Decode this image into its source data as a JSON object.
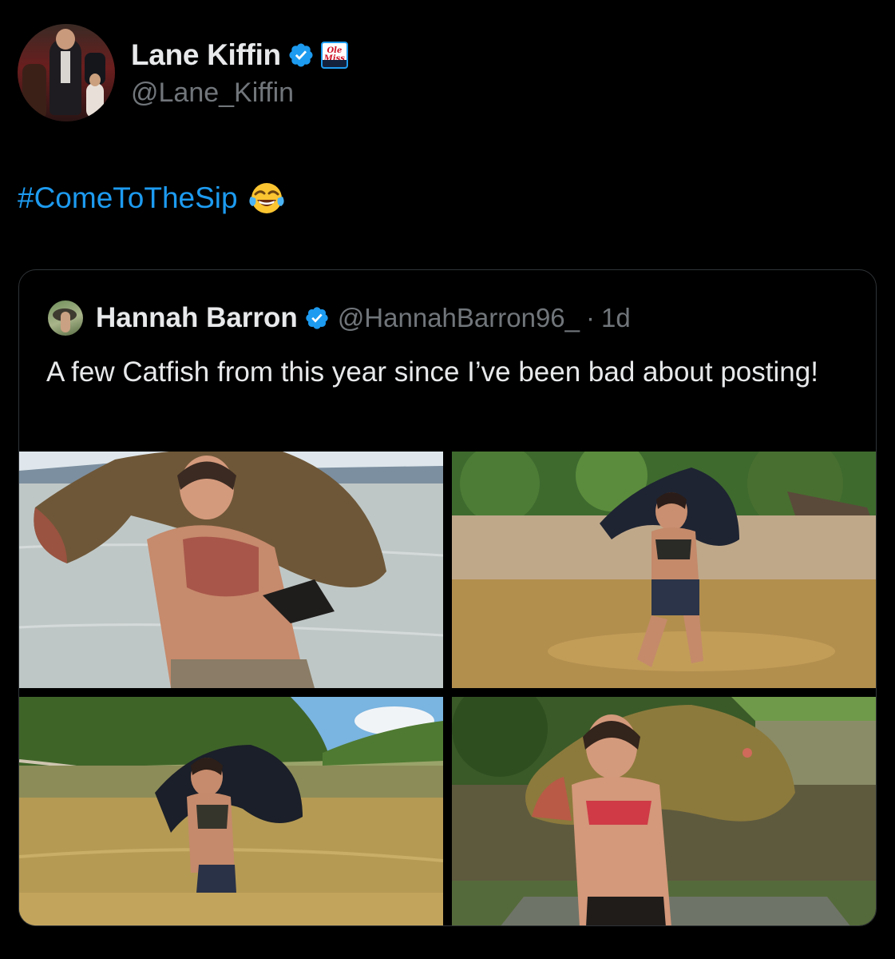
{
  "author": {
    "display_name": "Lane Kiffin",
    "handle": "@Lane_Kiffin",
    "avatar_icon": "profile-photo",
    "verified_icon": "verified-badge-icon",
    "affiliation_badge_text": "Ole Miss"
  },
  "tweet": {
    "text": "#ComeToTheSip",
    "emoji": "face-with-tears-of-joy"
  },
  "quoted_tweet": {
    "display_name": "Hannah Barron",
    "handle": "@HannahBarron96_",
    "separator": "·",
    "time": "1d",
    "text": "A few Catfish from this year since I’ve been bad about posting!",
    "photos": [
      {
        "subject": "woman holding catfish in lake"
      },
      {
        "subject": "woman holding catfish on muddy bank"
      },
      {
        "subject": "woman holding catfish in river"
      },
      {
        "subject": "woman holding catfish on boat"
      }
    ]
  },
  "colors": {
    "background": "#000000",
    "text": "#e7e9ea",
    "secondary": "#71767b",
    "accent": "#1d9bf0",
    "border": "#2f3336"
  }
}
